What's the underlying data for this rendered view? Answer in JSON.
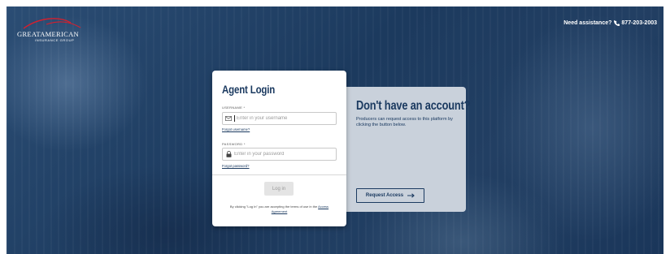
{
  "brand": {
    "name": "GREATAMERICAN",
    "sub": "INSURANCE GROUP",
    "logo_color": "#d3202f"
  },
  "assistance": {
    "label": "Need assistance?",
    "phone": "877-203-2003"
  },
  "login": {
    "title": "Agent Login",
    "username_label": "USERNAME *",
    "username_placeholder": "Enter in your username",
    "forgot_username": "Forgot username?",
    "password_label": "PASSWORD *",
    "password_placeholder": "Enter in your password",
    "forgot_password": "Forgot password?",
    "button": "Log in",
    "terms_prefix": "By clicking \"Log In\" you are accepting the terms of use in the",
    "terms_link": "Access Agreement"
  },
  "signup": {
    "title": "Don't have an account?",
    "text": "Producers can request access to this platform by clicking the button below.",
    "button": "Request Access"
  },
  "colors": {
    "navy": "#1b3a60",
    "hero": "#1e3c62",
    "panel": "#c9d1db"
  }
}
